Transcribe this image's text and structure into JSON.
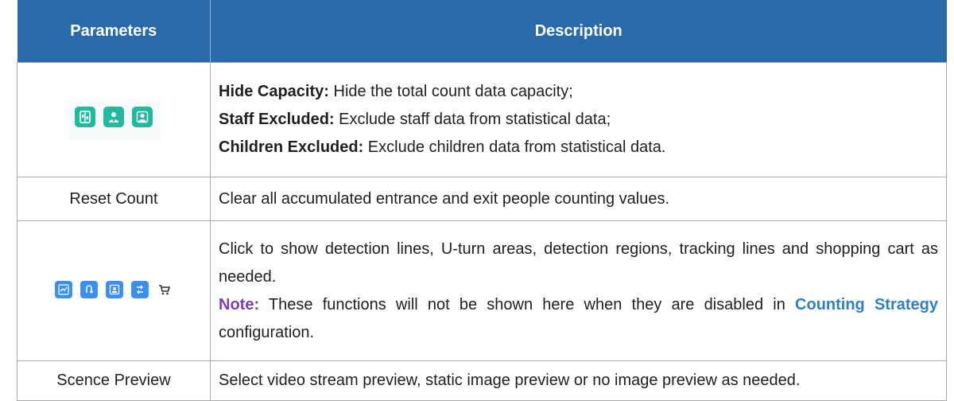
{
  "header": {
    "parameters": "Parameters",
    "description": "Description"
  },
  "rows": [
    {
      "icons": [
        "hide-capacity-icon",
        "staff-excluded-icon",
        "children-excluded-icon"
      ],
      "lines": [
        {
          "label": "Hide Capacity:",
          "text": " Hide the total count data capacity;"
        },
        {
          "label": "Staff Excluded:",
          "text": " Exclude staff data from statistical data;"
        },
        {
          "label": "Children Excluded:",
          "text": " Exclude children data from statistical data."
        }
      ]
    },
    {
      "param": "Reset Count",
      "description": "Clear all accumulated entrance and exit people counting values."
    },
    {
      "icons": [
        "detection-line-icon",
        "u-turn-area-icon",
        "detection-region-icon",
        "tracking-line-icon",
        "shopping-cart-icon"
      ],
      "description": "Click to show detection lines, U-turn areas, detection regions, tracking lines and shopping cart as needed.",
      "note_label": "Note:",
      "note_text": " These functions will not be shown here when they are disabled in ",
      "note_link": "Counting Strategy",
      "note_tail": " configuration."
    },
    {
      "param": "Scence Preview",
      "description": "Select video stream preview, static image preview or no image preview as needed."
    }
  ],
  "colors": {
    "header_bg": "#2b6aa8",
    "icon_green": "#21b9a0",
    "icon_blue": "#3a8ff0",
    "note": "#7b3fb0",
    "link": "#2f7fc4"
  }
}
